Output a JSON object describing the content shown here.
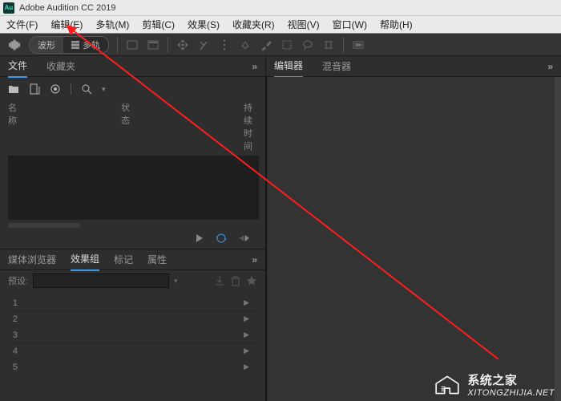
{
  "app": {
    "title": "Adobe Audition CC 2019",
    "logo_text": "Au"
  },
  "menu": {
    "file": "文件(F)",
    "edit": "编辑(E)",
    "multitrack": "多轨(M)",
    "clip": "剪辑(C)",
    "effects": "效果(S)",
    "favorites": "收藏夹(R)",
    "view": "视图(V)",
    "window": "窗口(W)",
    "help": "帮助(H)"
  },
  "toolbar": {
    "waveform": "波形",
    "multitrack": "多轨"
  },
  "files_panel": {
    "tab_files": "文件",
    "tab_fav": "收藏夹",
    "col_name": "名称",
    "col_status": "状态",
    "col_duration": "持续时间"
  },
  "editor_panel": {
    "tab_editor": "编辑器",
    "tab_mixer": "混音器"
  },
  "effects_panel": {
    "tab_media": "媒体浏览器",
    "tab_effects": "效果组",
    "tab_markers": "标记",
    "tab_props": "属性",
    "preset_label": "预设:",
    "rows": [
      "1",
      "2",
      "3",
      "4",
      "5"
    ]
  },
  "watermark": {
    "text_cn": "系统之家",
    "text_en": "XITONGZHIJIA.NET"
  }
}
